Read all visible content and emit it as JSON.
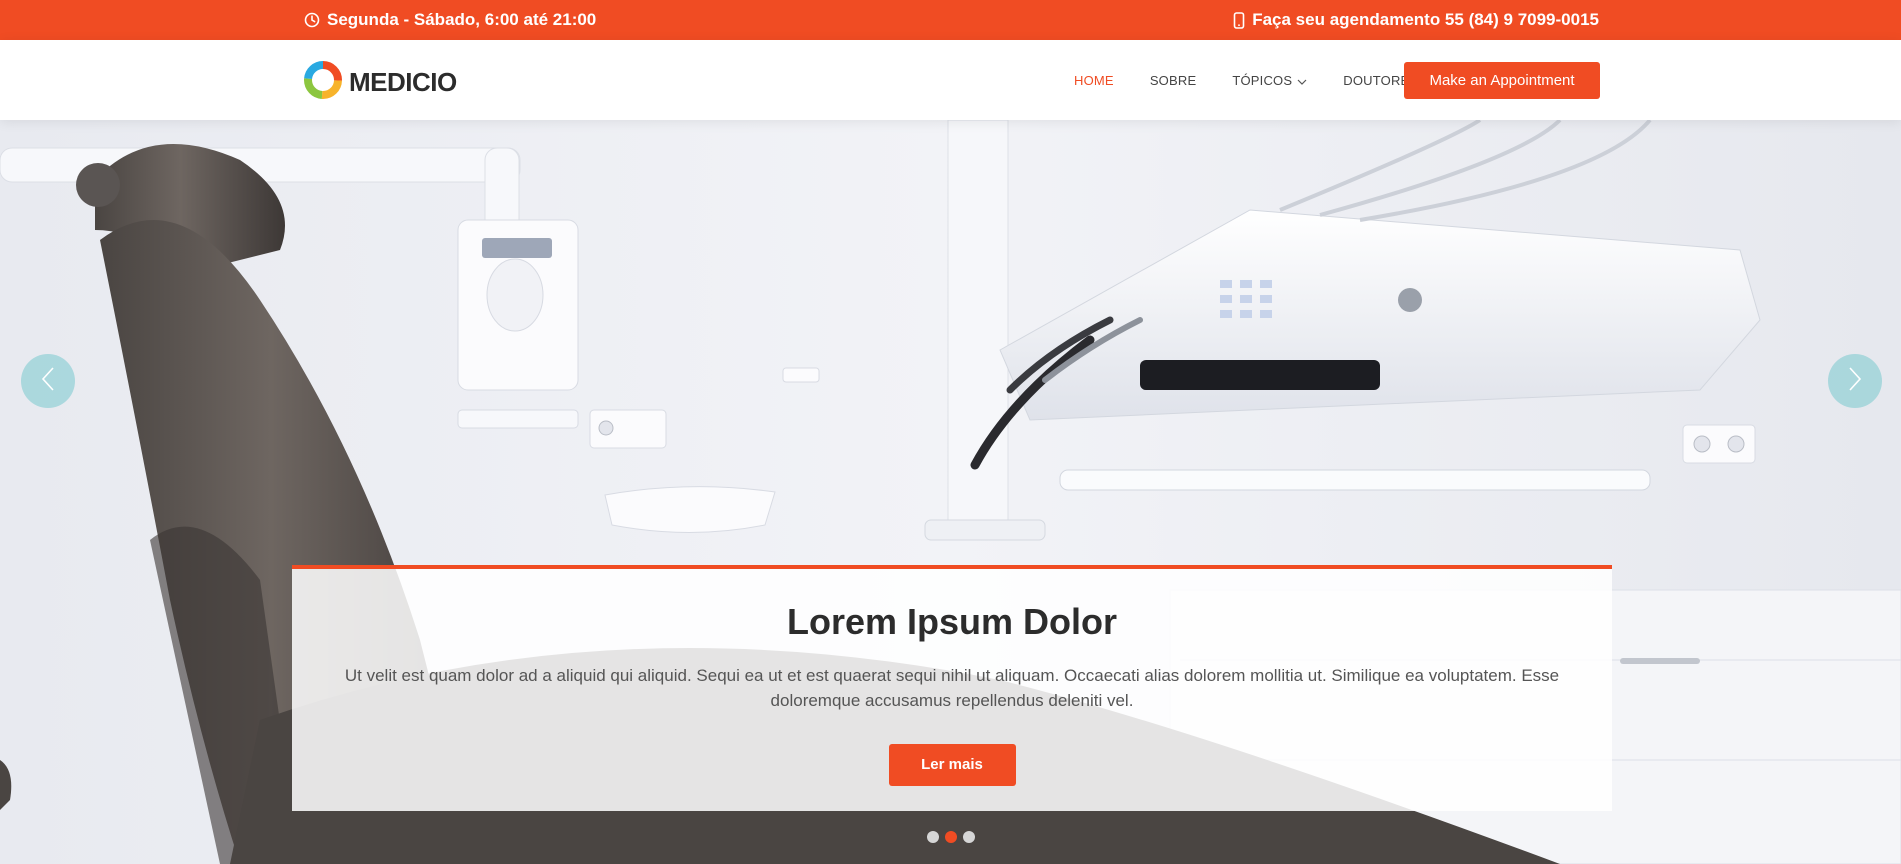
{
  "topbar": {
    "hours": "Segunda - Sábado, 6:00 até 21:00",
    "phone": "Faça seu agendamento 55 (84) 9 7099-0015",
    "background": "#f04c23",
    "hours_icon": "clock-icon",
    "phone_icon": "phone-icon"
  },
  "header": {
    "logo_text": "MEDICIO",
    "nav": [
      {
        "label": "HOME",
        "active": true
      },
      {
        "label": "SOBRE",
        "active": false
      },
      {
        "label": "TÓPICOS",
        "active": false,
        "dropdown": true
      },
      {
        "label": "DOUTORES",
        "active": false
      }
    ],
    "appointment_button": "Make an Appointment"
  },
  "hero": {
    "title": "Lorem Ipsum Dolor",
    "text": "Ut velit est quam dolor ad a aliquid qui aliquid. Sequi ea ut et est quaerat sequi nihil ut aliquam. Occaecati alias dolorem mollitia ut. Similique ea voluptatem. Esse doloremque accusamus repellendus deleniti vel.",
    "button": "Ler mais",
    "prev_icon": "chevron-left-icon",
    "next_icon": "chevron-right-icon",
    "slides": 3,
    "active_slide": 2
  },
  "colors": {
    "accent": "#f04c23",
    "arrow": "#78c8cd"
  }
}
